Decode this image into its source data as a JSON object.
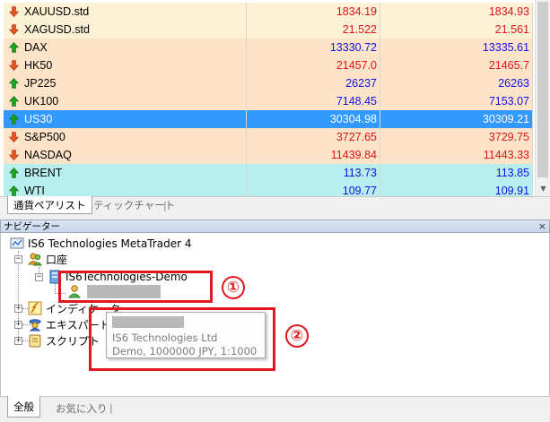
{
  "market_watch": {
    "rows": [
      {
        "symbol": "XAUUSD.std",
        "bid": "1834.19",
        "ask": "1834.93",
        "dir": "down",
        "bg": "#fdf1d6",
        "color": "#e0141a"
      },
      {
        "symbol": "XAGUSD.std",
        "bid": "21.522",
        "ask": "21.561",
        "dir": "down",
        "bg": "#fdf1d6",
        "color": "#e0141a"
      },
      {
        "symbol": "DAX",
        "bid": "13330.72",
        "ask": "13335.61",
        "dir": "up",
        "bg": "#fde4c8",
        "color": "#1010e6"
      },
      {
        "symbol": "HK50",
        "bid": "21457.0",
        "ask": "21465.7",
        "dir": "down",
        "bg": "#fde4c8",
        "color": "#e0141a"
      },
      {
        "symbol": "JP225",
        "bid": "26237",
        "ask": "26263",
        "dir": "up",
        "bg": "#fde4c8",
        "color": "#1010e6"
      },
      {
        "symbol": "UK100",
        "bid": "7148.45",
        "ask": "7153.07",
        "dir": "up",
        "bg": "#fde4c8",
        "color": "#1010e6"
      },
      {
        "symbol": "US30",
        "bid": "30304.98",
        "ask": "30309.21",
        "dir": "up",
        "bg": "#3399ff",
        "color": "#ffffff",
        "selected": true
      },
      {
        "symbol": "S&P500",
        "bid": "3727.65",
        "ask": "3729.75",
        "dir": "down",
        "bg": "#fde4c8",
        "color": "#e0141a"
      },
      {
        "symbol": "NASDAQ",
        "bid": "11439.84",
        "ask": "11443.33",
        "dir": "down",
        "bg": "#fde4c8",
        "color": "#e0141a"
      },
      {
        "symbol": "BRENT",
        "bid": "113.73",
        "ask": "113.85",
        "dir": "up",
        "bg": "#b7eeee",
        "color": "#1010e6"
      },
      {
        "symbol": "WTI",
        "bid": "109.77",
        "ask": "109.91",
        "dir": "up",
        "bg": "#b7eeee",
        "color": "#1010e6"
      }
    ],
    "tabs": {
      "symbols": "通貨ペアリスト",
      "tick_chart": "ティックチャート",
      "sep": "|"
    },
    "scroll_down": "▼"
  },
  "navigator": {
    "title": "ナビゲーター",
    "close": "×",
    "root": "IS6 Technologies MetaTrader 4",
    "accounts": "口座",
    "server": "IS6Technologies-Demo",
    "indicators": "インディケータ",
    "experts": "エキスパートア",
    "scripts": "スクリプト",
    "tooltip_line1": "IS6 Technologies Ltd",
    "tooltip_line2": "Demo, 1000000 JPY, 1:1000",
    "callout1": "①",
    "callout2": "②",
    "tabs": {
      "all": "全般",
      "favorites": "お気に入り",
      "sep": "|"
    }
  },
  "colors": {
    "up_arrow": "#1fa31f",
    "down_arrow": "#e8541f",
    "callout": "#e0181f"
  }
}
